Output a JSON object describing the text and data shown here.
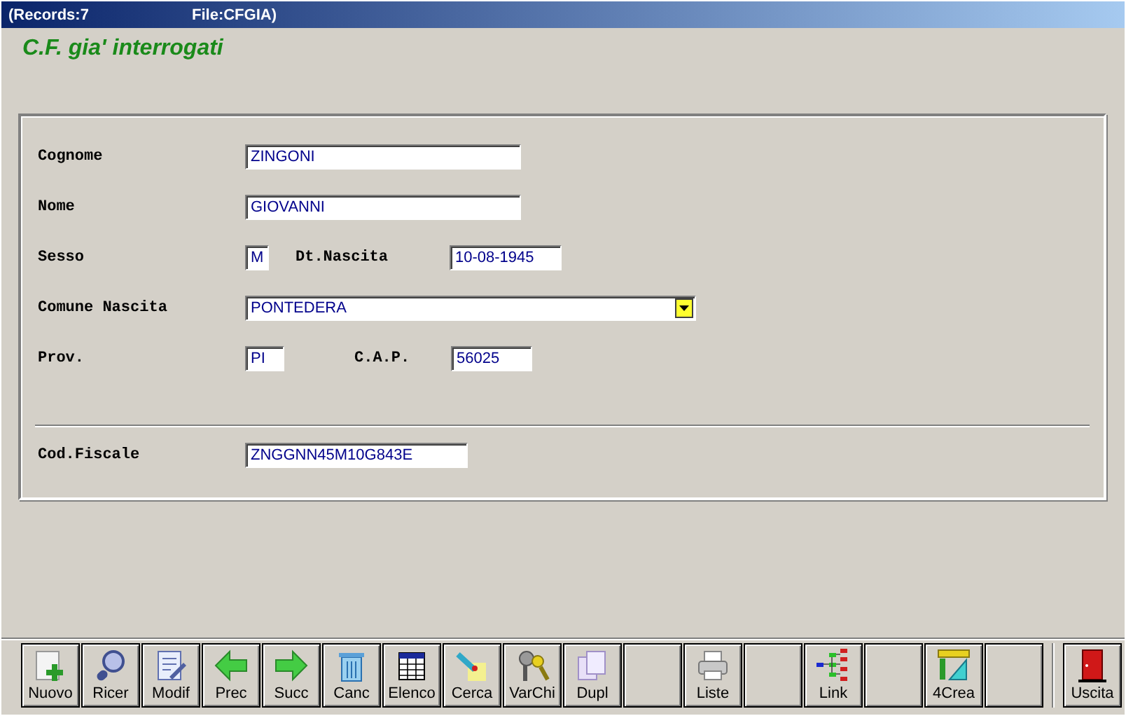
{
  "window": {
    "title_records": "(Records:7",
    "title_file": "File:CFGIA)"
  },
  "heading": "C.F. gia' interrogati",
  "form": {
    "rows": [
      {
        "fields": [
          {
            "label": "Cognome",
            "value": "ZINGONI",
            "kind": "text"
          }
        ]
      },
      {
        "fields": [
          {
            "label": "Nome",
            "value": "GIOVANNI",
            "kind": "text"
          }
        ]
      },
      {
        "fields": [
          {
            "label": "Sesso",
            "value": "M",
            "kind": "text"
          },
          {
            "label": "Dt.Nascita",
            "value": "10-08-1945",
            "kind": "text"
          }
        ]
      },
      {
        "fields": [
          {
            "label": "Comune Nascita",
            "value": "PONTEDERA",
            "kind": "dropdown"
          }
        ]
      },
      {
        "fields": [
          {
            "label": "Prov.",
            "value": "PI",
            "kind": "text"
          },
          {
            "label": "C.A.P.",
            "value": "56025",
            "kind": "text"
          }
        ]
      }
    ],
    "footer": {
      "label": "Cod.Fiscale",
      "value": "ZNGGNN45M10G843E",
      "kind": "text"
    }
  },
  "toolbar": [
    {
      "kind": "button",
      "label": "Nuovo"
    },
    {
      "kind": "button",
      "label": "Ricer"
    },
    {
      "kind": "button",
      "label": "Modif"
    },
    {
      "kind": "button",
      "label": "Prec"
    },
    {
      "kind": "button",
      "label": "Succ"
    },
    {
      "kind": "button",
      "label": "Canc"
    },
    {
      "kind": "button",
      "label": "Elenco"
    },
    {
      "kind": "button",
      "label": "Cerca"
    },
    {
      "kind": "button",
      "label": "VarChi"
    },
    {
      "kind": "button",
      "label": "Dupl"
    },
    {
      "kind": "blank"
    },
    {
      "kind": "button",
      "label": "Liste"
    },
    {
      "kind": "blank"
    },
    {
      "kind": "button",
      "label": "Link"
    },
    {
      "kind": "blank"
    },
    {
      "kind": "button",
      "label": "4Crea"
    },
    {
      "kind": "blank"
    },
    {
      "kind": "separator"
    },
    {
      "kind": "button",
      "label": "Uscita"
    }
  ]
}
